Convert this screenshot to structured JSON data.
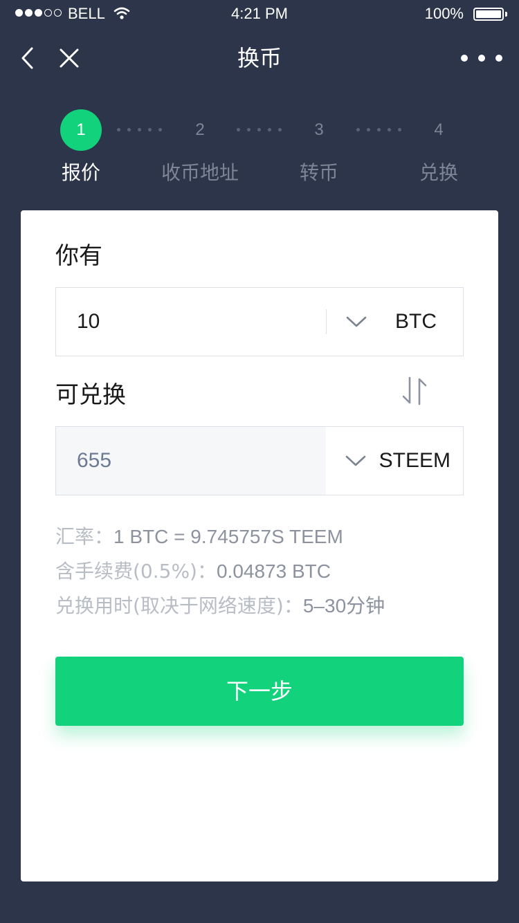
{
  "status_bar": {
    "carrier": "BELL",
    "time": "4:21 PM",
    "battery": "100%"
  },
  "nav": {
    "title": "换币"
  },
  "steps": [
    {
      "number": "1",
      "label": "报价"
    },
    {
      "number": "2",
      "label": "收币地址"
    },
    {
      "number": "3",
      "label": "转币"
    },
    {
      "number": "4",
      "label": "兑换"
    }
  ],
  "active_step": 1,
  "form": {
    "have_label": "你有",
    "have_amount": "10",
    "have_currency": "BTC",
    "receive_label": "可兑换",
    "receive_amount": "655",
    "receive_currency": "STEEM"
  },
  "info": {
    "rate_label": "汇率：",
    "rate_value": "1 BTC = 9.745757S TEEM",
    "fee_label": "含手续费(0.5%)：",
    "fee_value": "0.04873 BTC",
    "time_label": "兑换用时(取决于网络速度)：",
    "time_value": "5–30分钟"
  },
  "actions": {
    "next_label": "下一步"
  },
  "colors": {
    "background": "#2c354a",
    "accent": "#12d27b",
    "card": "#ffffff",
    "muted_text": "#b8bcc4"
  },
  "icons": [
    "back-arrow-icon",
    "close-icon",
    "more-icon",
    "chevron-down-icon",
    "swap-arrows-icon",
    "wifi-icon"
  ]
}
